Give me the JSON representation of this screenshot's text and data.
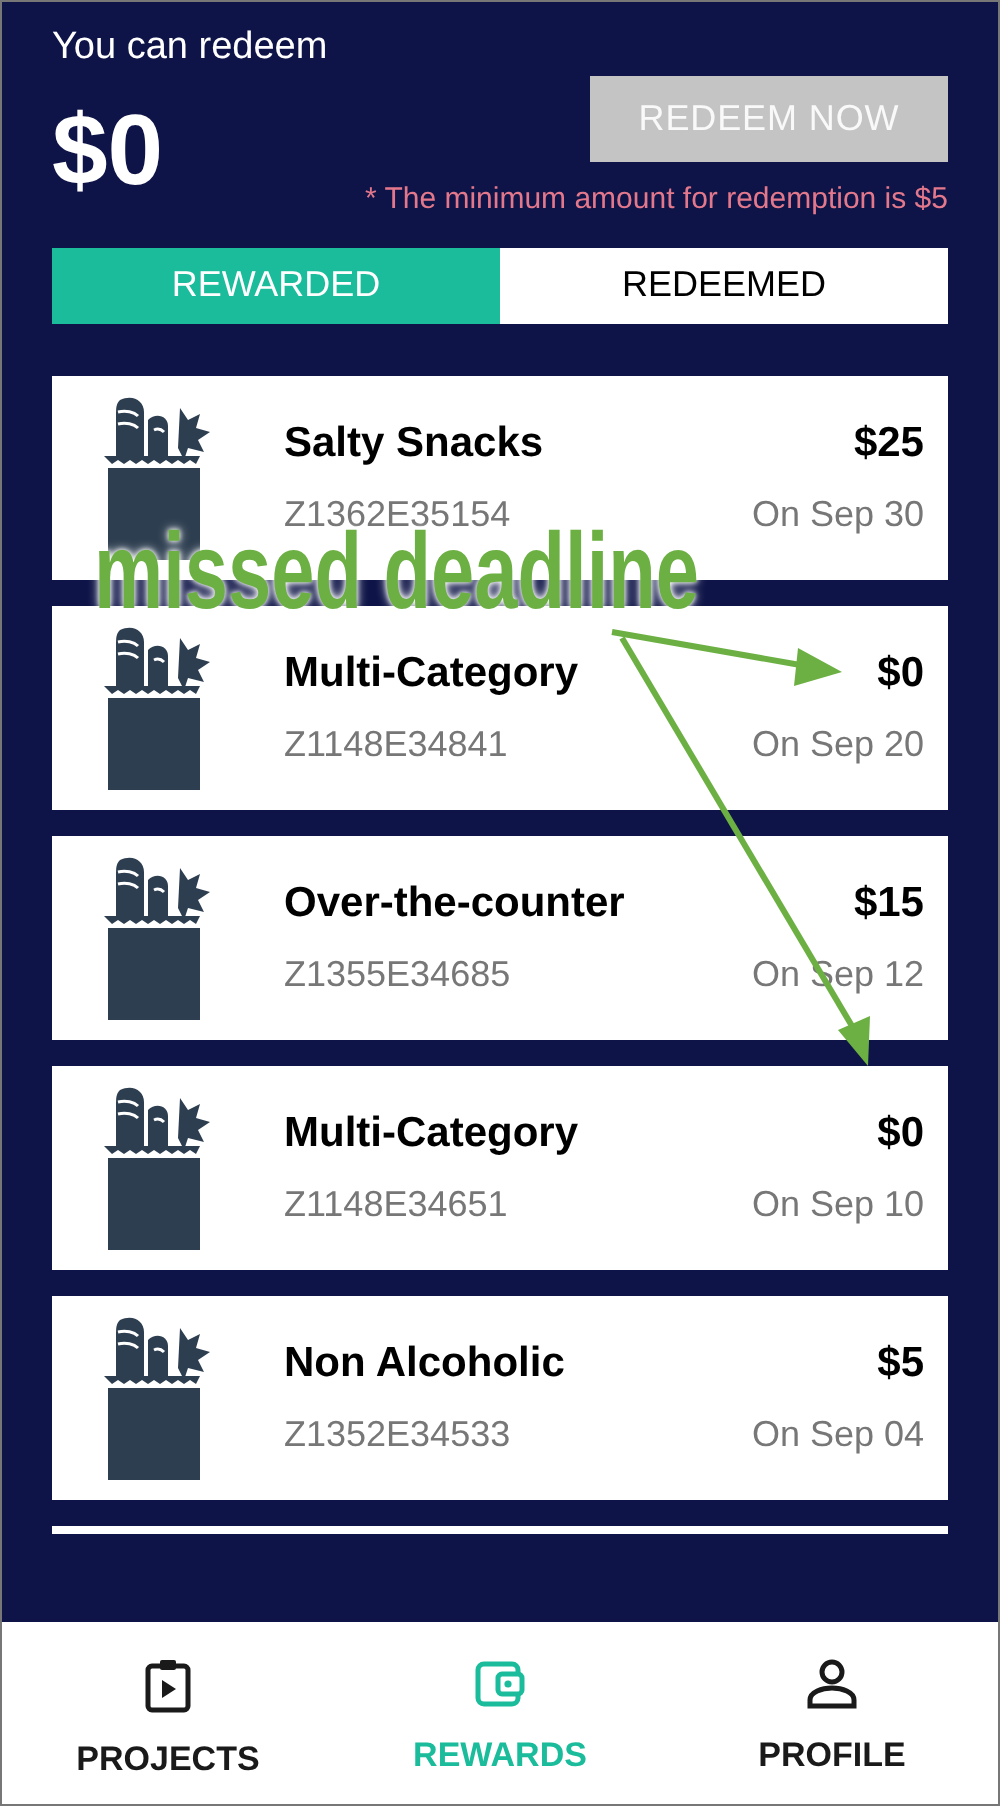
{
  "header": {
    "label": "You can redeem",
    "amount": "$0",
    "button": {
      "label": "REDEEM NOW",
      "disabled": true
    },
    "note": "* The minimum amount for redemption is $5"
  },
  "tabs": [
    {
      "label": "REWARDED",
      "selected": true
    },
    {
      "label": "REDEEMED",
      "selected": false
    }
  ],
  "rewards": [
    {
      "title": "Salty Snacks",
      "code": "Z1362E35154",
      "amount": "$25",
      "date": "On Sep 30"
    },
    {
      "title": "Multi-Category",
      "code": "Z1148E34841",
      "amount": "$0",
      "date": "On Sep 20"
    },
    {
      "title": "Over-the-counter",
      "code": "Z1355E34685",
      "amount": "$15",
      "date": "On Sep 12"
    },
    {
      "title": "Multi-Category",
      "code": "Z1148E34651",
      "amount": "$0",
      "date": "On Sep 10"
    },
    {
      "title": "Non Alcoholic",
      "code": "Z1352E34533",
      "amount": "$5",
      "date": "On Sep 04"
    }
  ],
  "annotation": {
    "text": "missed deadline"
  },
  "nav": [
    {
      "label": "PROJECTS",
      "selected": false
    },
    {
      "label": "REWARDS",
      "selected": true
    },
    {
      "label": "PROFILE",
      "selected": false
    }
  ]
}
